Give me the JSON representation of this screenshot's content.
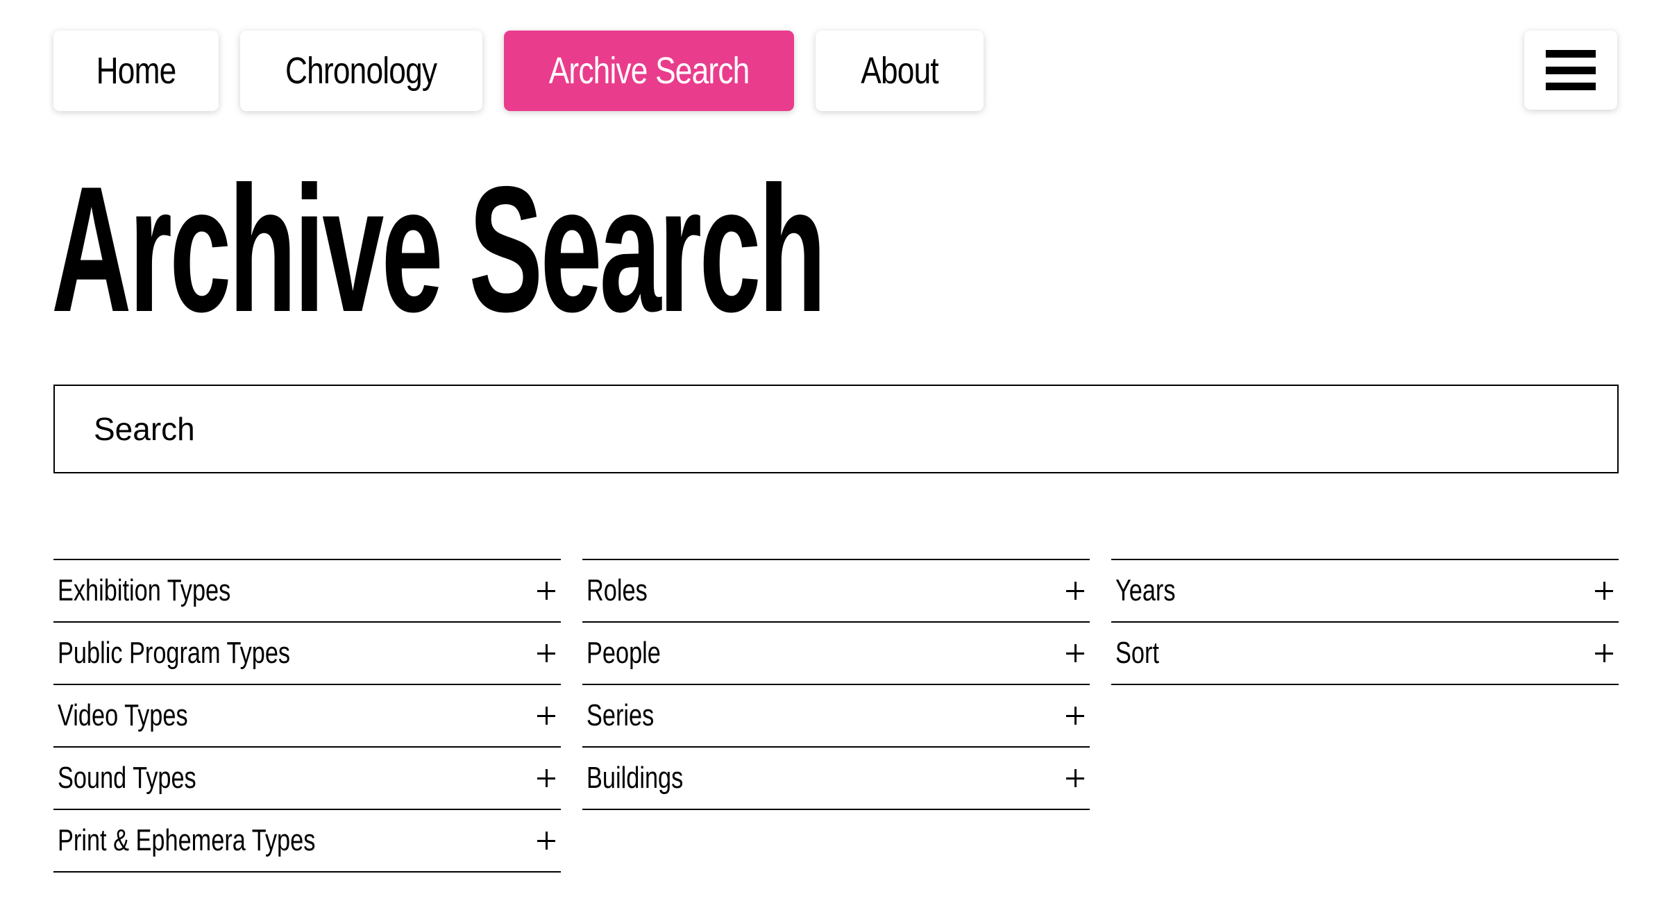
{
  "nav": {
    "items": [
      {
        "label": "Home"
      },
      {
        "label": "Chronology"
      },
      {
        "label": "Archive Search",
        "active": true
      },
      {
        "label": "About"
      }
    ],
    "active_color": "#ea3c8c",
    "menu_icon": "hamburger-icon"
  },
  "page": {
    "title": "Archive Search"
  },
  "search": {
    "placeholder": "Search",
    "value": ""
  },
  "filters": {
    "columns": [
      {
        "items": [
          {
            "label": "Exhibition Types"
          },
          {
            "label": "Public Program Types"
          },
          {
            "label": "Video Types"
          },
          {
            "label": "Sound Types"
          },
          {
            "label": "Print & Ephemera Types"
          }
        ]
      },
      {
        "items": [
          {
            "label": "Roles"
          },
          {
            "label": "People"
          },
          {
            "label": "Series"
          },
          {
            "label": "Buildings"
          }
        ]
      },
      {
        "items": [
          {
            "label": "Years"
          },
          {
            "label": "Sort"
          }
        ]
      }
    ],
    "expand_icon": "plus-icon"
  }
}
